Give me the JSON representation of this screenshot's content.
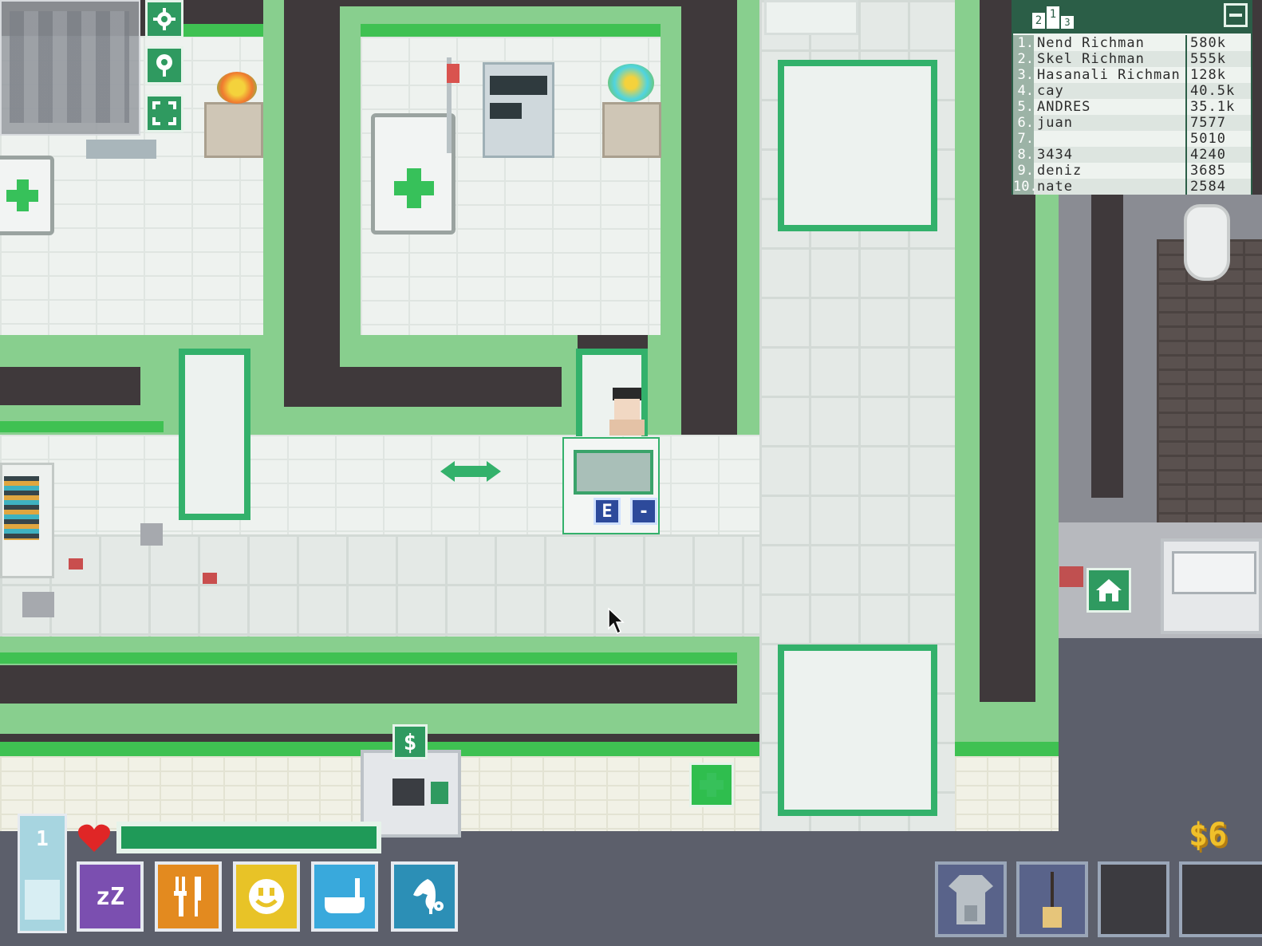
{
  "leaderboard": {
    "rows": [
      {
        "rank": "1.",
        "name": "Nend Richman",
        "score": "580k"
      },
      {
        "rank": "2.",
        "name": "Skel Richman",
        "score": "555k"
      },
      {
        "rank": "3.",
        "name": "Hasanali Richman",
        "score": "128k"
      },
      {
        "rank": "4.",
        "name": "cay",
        "score": "40.5k"
      },
      {
        "rank": "5.",
        "name": "ANDRES",
        "score": "35.1k"
      },
      {
        "rank": "6.",
        "name": "juan",
        "score": "7577"
      },
      {
        "rank": "7.",
        "name": "",
        "score": "5010"
      },
      {
        "rank": "8.",
        "name": "3434",
        "score": "4240"
      },
      {
        "rank": "9.",
        "name": "deniz",
        "score": "3685"
      },
      {
        "rank": "10.",
        "name": "nate",
        "score": "2584"
      }
    ],
    "podium": [
      "2",
      "1",
      "3"
    ],
    "collapse_icon": "minimize-icon"
  },
  "hud": {
    "level": "1",
    "health_fraction": 1.0,
    "money": "$6",
    "needs": [
      {
        "name": "sleep",
        "icon": "sleep-icon",
        "label": "zZ",
        "color": "#7b4fb0"
      },
      {
        "name": "food",
        "icon": "fork-knife-icon",
        "color": "#e38a1f"
      },
      {
        "name": "fun",
        "icon": "smiley-icon",
        "color": "#e8c327"
      },
      {
        "name": "hygiene",
        "icon": "bathtub-icon",
        "color": "#39a9dc"
      },
      {
        "name": "skills",
        "icon": "chess-knight-icon",
        "color": "#2c8fb6"
      }
    ],
    "inventory": [
      {
        "item": "shirt-icon"
      },
      {
        "item": "broom-icon"
      },
      {
        "item": ""
      },
      {
        "item": ""
      }
    ],
    "side_buttons": [
      "settings-icon",
      "map-pin-icon",
      "fullscreen-icon"
    ]
  },
  "world": {
    "interact_keys": [
      "E",
      "-"
    ],
    "signs": [
      "cross-sign",
      "home-sign",
      "dollar-sign"
    ]
  },
  "colors": {
    "wall_green": "#88cf8e",
    "accent_green": "#33b16b",
    "leaderboard_header": "#2b5e47"
  }
}
